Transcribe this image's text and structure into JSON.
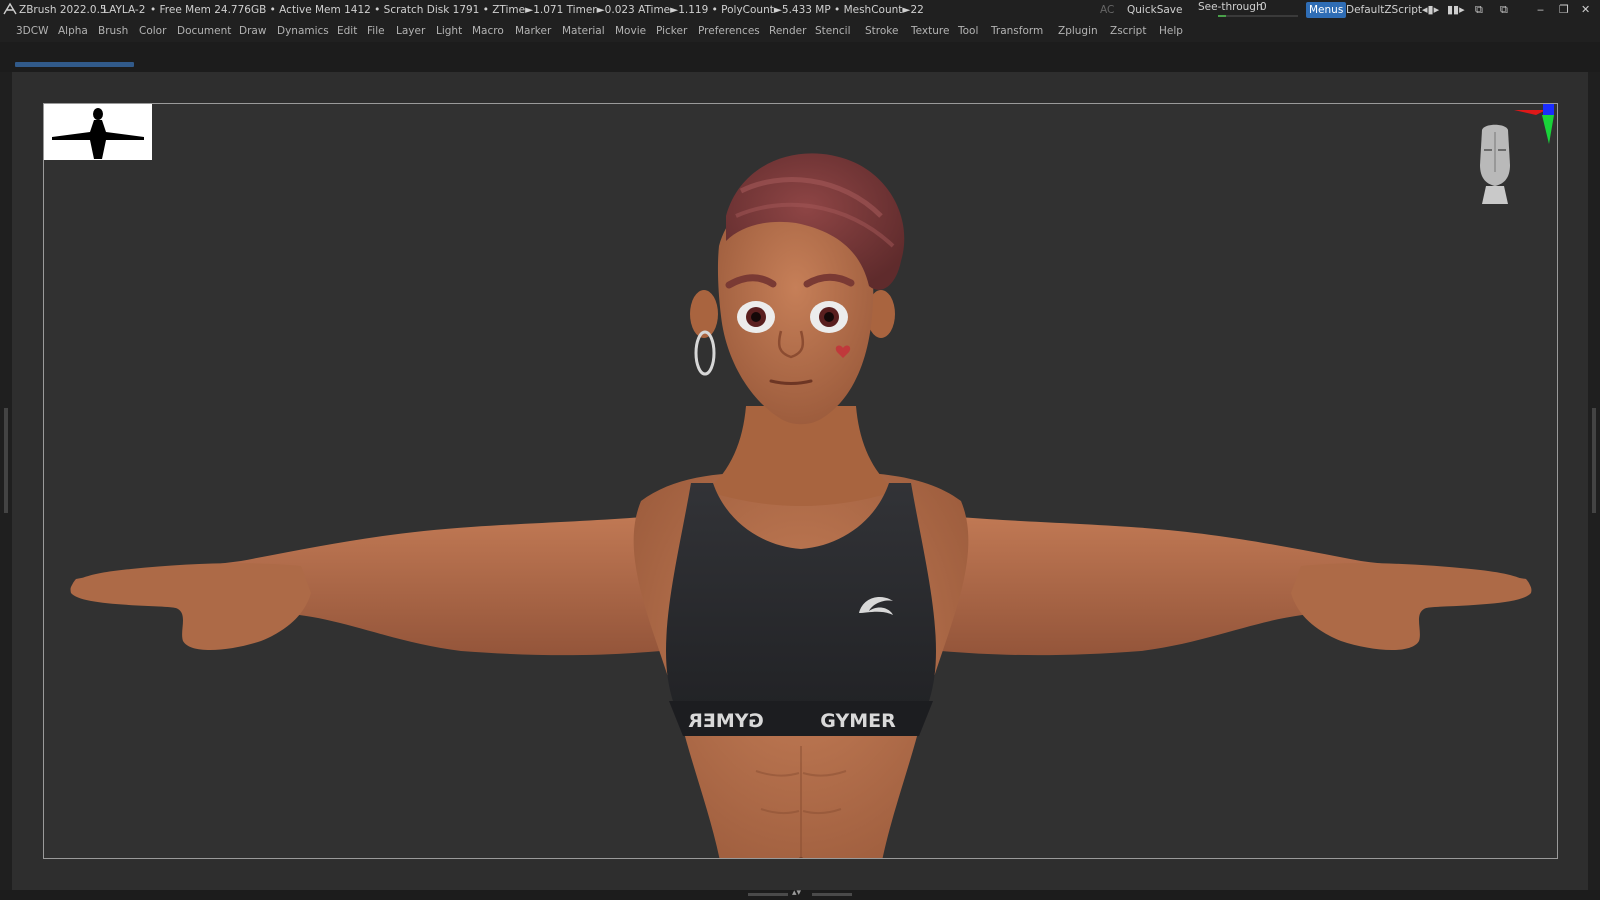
{
  "titlebar": {
    "app": "ZBrush 2022.0.5",
    "document": "LAYLA-2",
    "stats": "• Free Mem 24.776GB • Active Mem 1412 • Scratch Disk 1791 • ZTime►1.071 Timer►0.023 ATime►1.119 • PolyCount►5.433 MP • MeshCount►22",
    "ac": "AC",
    "quicksave": "QuickSave",
    "seethrough_label": "See-through",
    "seethrough_value": "0",
    "seethrough_level": 0,
    "menus": "Menus",
    "script": "DefaultZScript"
  },
  "menubar": {
    "items": [
      "3DCW",
      "Alpha",
      "Brush",
      "Color",
      "Document",
      "Draw",
      "Dynamics",
      "Edit",
      "File",
      "Layer",
      "Light",
      "Macro",
      "Marker",
      "Material",
      "Movie",
      "Picker",
      "Preferences",
      "Render",
      "Stencil",
      "Stroke",
      "Texture",
      "Tool",
      "Transform",
      "Zplugin",
      "Zscript",
      "Help"
    ]
  },
  "model": {
    "top_lettering_left": "GYMER",
    "top_lettering_right": "GYMER"
  },
  "colors": {
    "skin": "#b8714c",
    "hair": "#7a3a3a",
    "top": "#2a2b2e",
    "accent": "#2f6db5"
  },
  "icons": {
    "app": "zbrush-logo-icon",
    "minimize": "minimize-icon",
    "restore": "restore-icon",
    "close": "close-icon"
  }
}
